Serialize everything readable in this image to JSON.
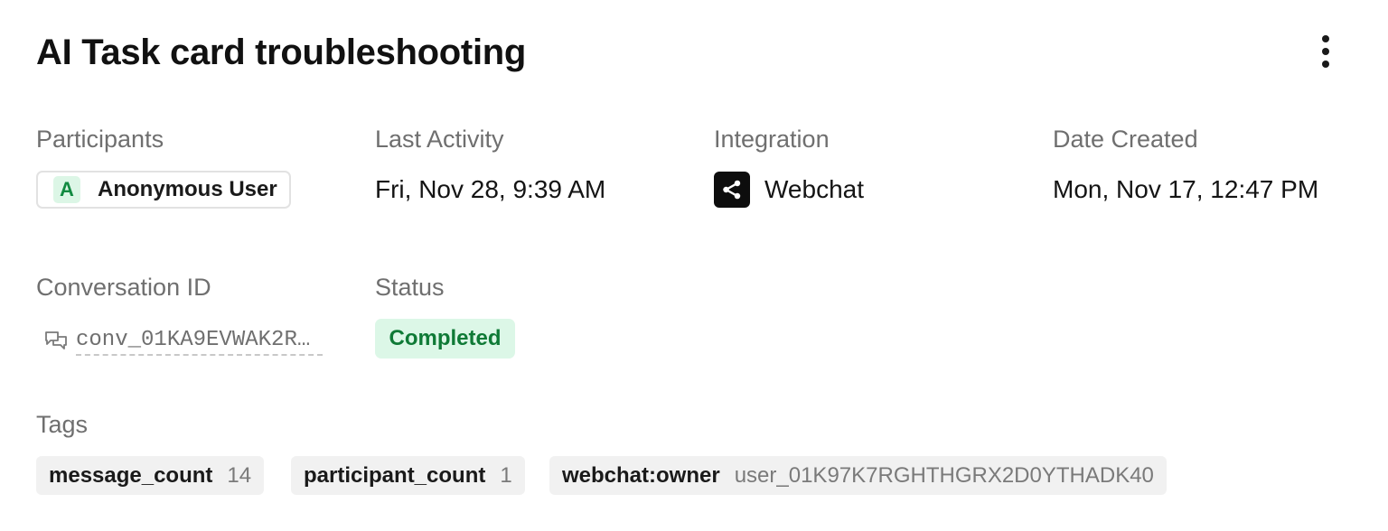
{
  "header": {
    "title": "AI Task card troubleshooting",
    "more_icon": "vertical-ellipsis-icon"
  },
  "details": {
    "participants": {
      "label": "Participants",
      "avatar_initial": "A",
      "name": "Anonymous User"
    },
    "last_activity": {
      "label": "Last Activity",
      "value": "Fri, Nov 28, 9:39 AM"
    },
    "integration": {
      "label": "Integration",
      "icon": "share-icon",
      "value": "Webchat"
    },
    "date_created": {
      "label": "Date Created",
      "value": "Mon, Nov 17, 12:47 PM"
    },
    "conversation_id": {
      "label": "Conversation ID",
      "icon": "chat-bubbles-icon",
      "value": "conv_01KA9EVWAK2RE…"
    },
    "status": {
      "label": "Status",
      "value": "Completed"
    }
  },
  "tags": {
    "label": "Tags",
    "items": [
      {
        "key": "message_count",
        "value": "14"
      },
      {
        "key": "participant_count",
        "value": "1"
      },
      {
        "key": "webchat:owner",
        "value": "user_01K97K7RGHTHGRX2D0YTHADK40"
      }
    ]
  },
  "colors": {
    "status_bg": "#dcf7e7",
    "status_text": "#0f7a36",
    "avatar_bg": "#dcf6e6",
    "avatar_text": "#128a41",
    "label_text": "#6f6f6f",
    "tag_bg": "#f1f1f1"
  }
}
